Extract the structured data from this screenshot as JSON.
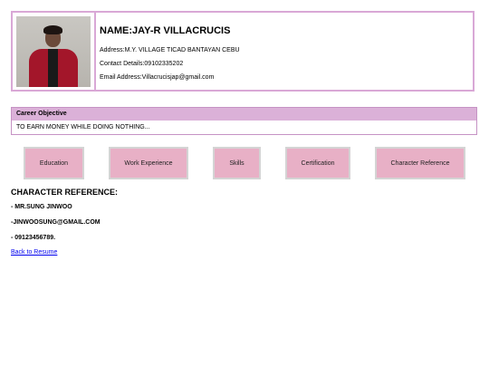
{
  "profile": {
    "name": "NAME:JAY-R VILLACRUCIS",
    "address": "Address:M.Y. VILLAGE TICAD BANTAYAN CEBU",
    "contact": "Contact Details:09102335202",
    "email": "Email Address:Villacrucisjap@gmail.com"
  },
  "objective": {
    "heading": "Career Objective",
    "text": "TO EARN MONEY WHILE DOING NOTHING..."
  },
  "nav": {
    "education": "Education",
    "work_experience": "Work Experience",
    "skills": "Skills",
    "certification": "Certification",
    "character_reference": "Character Reference"
  },
  "reference": {
    "title": "CHARACTER REFERENCE:",
    "name": "- MR.SUNG JINWOO",
    "email": "-JINWOOSUNG@GMAIL.COM",
    "phone": "- 09123456789."
  },
  "back_link": "Back to Resume",
  "colors": {
    "border": "#d9a8d6",
    "objective_header": "#dbb1d8",
    "button_bg": "#e8b0c6",
    "link": "#0000ee"
  }
}
